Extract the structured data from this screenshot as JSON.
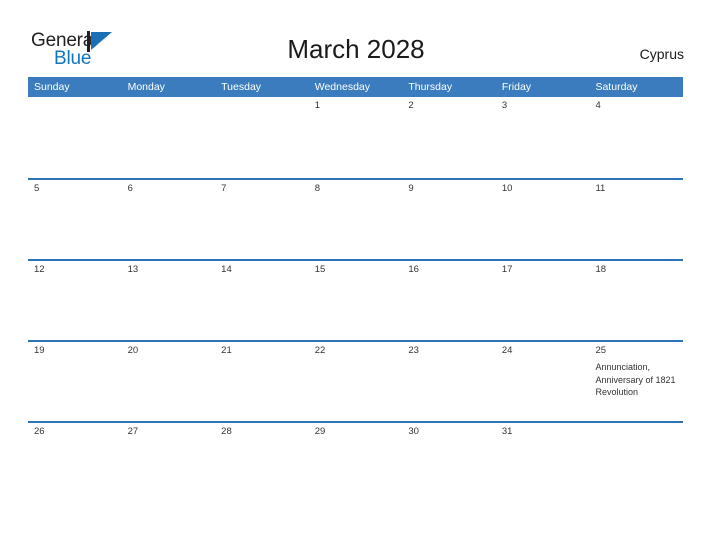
{
  "brand": {
    "name_part1": "General",
    "name_part2": "Blue",
    "logo_icon": "triangle-flag-icon"
  },
  "header": {
    "title": "March 2028",
    "country": "Cyprus"
  },
  "calendar": {
    "month": "March",
    "year": "2028",
    "weekday_headers": [
      "Sunday",
      "Monday",
      "Tuesday",
      "Wednesday",
      "Thursday",
      "Friday",
      "Saturday"
    ],
    "weeks": [
      [
        {
          "day": "",
          "events": []
        },
        {
          "day": "",
          "events": []
        },
        {
          "day": "",
          "events": []
        },
        {
          "day": "1",
          "events": []
        },
        {
          "day": "2",
          "events": []
        },
        {
          "day": "3",
          "events": []
        },
        {
          "day": "4",
          "events": []
        }
      ],
      [
        {
          "day": "5",
          "events": []
        },
        {
          "day": "6",
          "events": []
        },
        {
          "day": "7",
          "events": []
        },
        {
          "day": "8",
          "events": []
        },
        {
          "day": "9",
          "events": []
        },
        {
          "day": "10",
          "events": []
        },
        {
          "day": "11",
          "events": []
        }
      ],
      [
        {
          "day": "12",
          "events": []
        },
        {
          "day": "13",
          "events": []
        },
        {
          "day": "14",
          "events": []
        },
        {
          "day": "15",
          "events": []
        },
        {
          "day": "16",
          "events": []
        },
        {
          "day": "17",
          "events": []
        },
        {
          "day": "18",
          "events": []
        }
      ],
      [
        {
          "day": "19",
          "events": []
        },
        {
          "day": "20",
          "events": []
        },
        {
          "day": "21",
          "events": []
        },
        {
          "day": "22",
          "events": []
        },
        {
          "day": "23",
          "events": []
        },
        {
          "day": "24",
          "events": []
        },
        {
          "day": "25",
          "events": [
            "Annunciation, Anniversary of 1821 Revolution"
          ]
        }
      ],
      [
        {
          "day": "26",
          "events": []
        },
        {
          "day": "27",
          "events": []
        },
        {
          "day": "28",
          "events": []
        },
        {
          "day": "29",
          "events": []
        },
        {
          "day": "30",
          "events": []
        },
        {
          "day": "31",
          "events": []
        },
        {
          "day": "",
          "events": []
        }
      ]
    ]
  },
  "colors": {
    "header_blue": "#3b7cbe",
    "row_divider_blue": "#2f72b5",
    "day_band_gray": "#f0f0f0",
    "brand_blue": "#1175c0",
    "text_dark": "#333333"
  }
}
